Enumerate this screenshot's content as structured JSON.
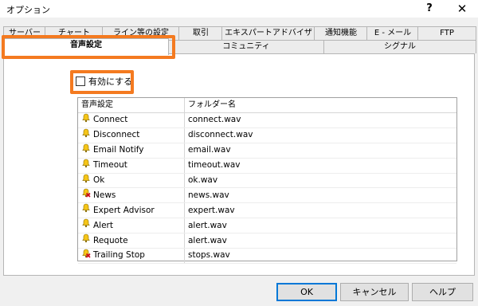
{
  "window": {
    "title": "オプション",
    "help_glyph": "?",
    "close_glyph": "✕"
  },
  "tabs_row1": [
    {
      "label": "サーバー"
    },
    {
      "label": "チャート"
    },
    {
      "label": "ライン等の設定"
    },
    {
      "label": "取引"
    },
    {
      "label": "エキスパートアドバイザ"
    },
    {
      "label": "通知機能"
    },
    {
      "label": "E - メール"
    },
    {
      "label": "FTP"
    }
  ],
  "tabs_row2": [
    {
      "label": "音声設定",
      "active": true
    },
    {
      "label": "コミュニティ"
    },
    {
      "label": "シグナル"
    }
  ],
  "enable_label": "有効にする",
  "table": {
    "headers": [
      "音声設定",
      "フォルダー名"
    ],
    "rows": [
      {
        "event": "Connect",
        "file": "connect.wav",
        "icon": "bell-icon"
      },
      {
        "event": "Disconnect",
        "file": "disconnect.wav",
        "icon": "bell-icon"
      },
      {
        "event": "Email Notify",
        "file": "email.wav",
        "icon": "bell-icon"
      },
      {
        "event": "Timeout",
        "file": "timeout.wav",
        "icon": "bell-icon"
      },
      {
        "event": "Ok",
        "file": "ok.wav",
        "icon": "bell-icon"
      },
      {
        "event": "News",
        "file": "news.wav",
        "icon": "bell-disabled-icon"
      },
      {
        "event": "Expert Advisor",
        "file": "expert.wav",
        "icon": "bell-icon"
      },
      {
        "event": "Alert",
        "file": "alert.wav",
        "icon": "bell-icon"
      },
      {
        "event": "Requote",
        "file": "alert.wav",
        "icon": "bell-icon"
      },
      {
        "event": "Trailing Stop",
        "file": "stops.wav",
        "icon": "bell-disabled-icon"
      }
    ]
  },
  "buttons": {
    "ok": "OK",
    "cancel": "キャンセル",
    "help": "ヘルプ"
  },
  "colors": {
    "highlight": "#f47a20",
    "bell": "#f5c518",
    "disabled_mark": "#d0021b"
  }
}
